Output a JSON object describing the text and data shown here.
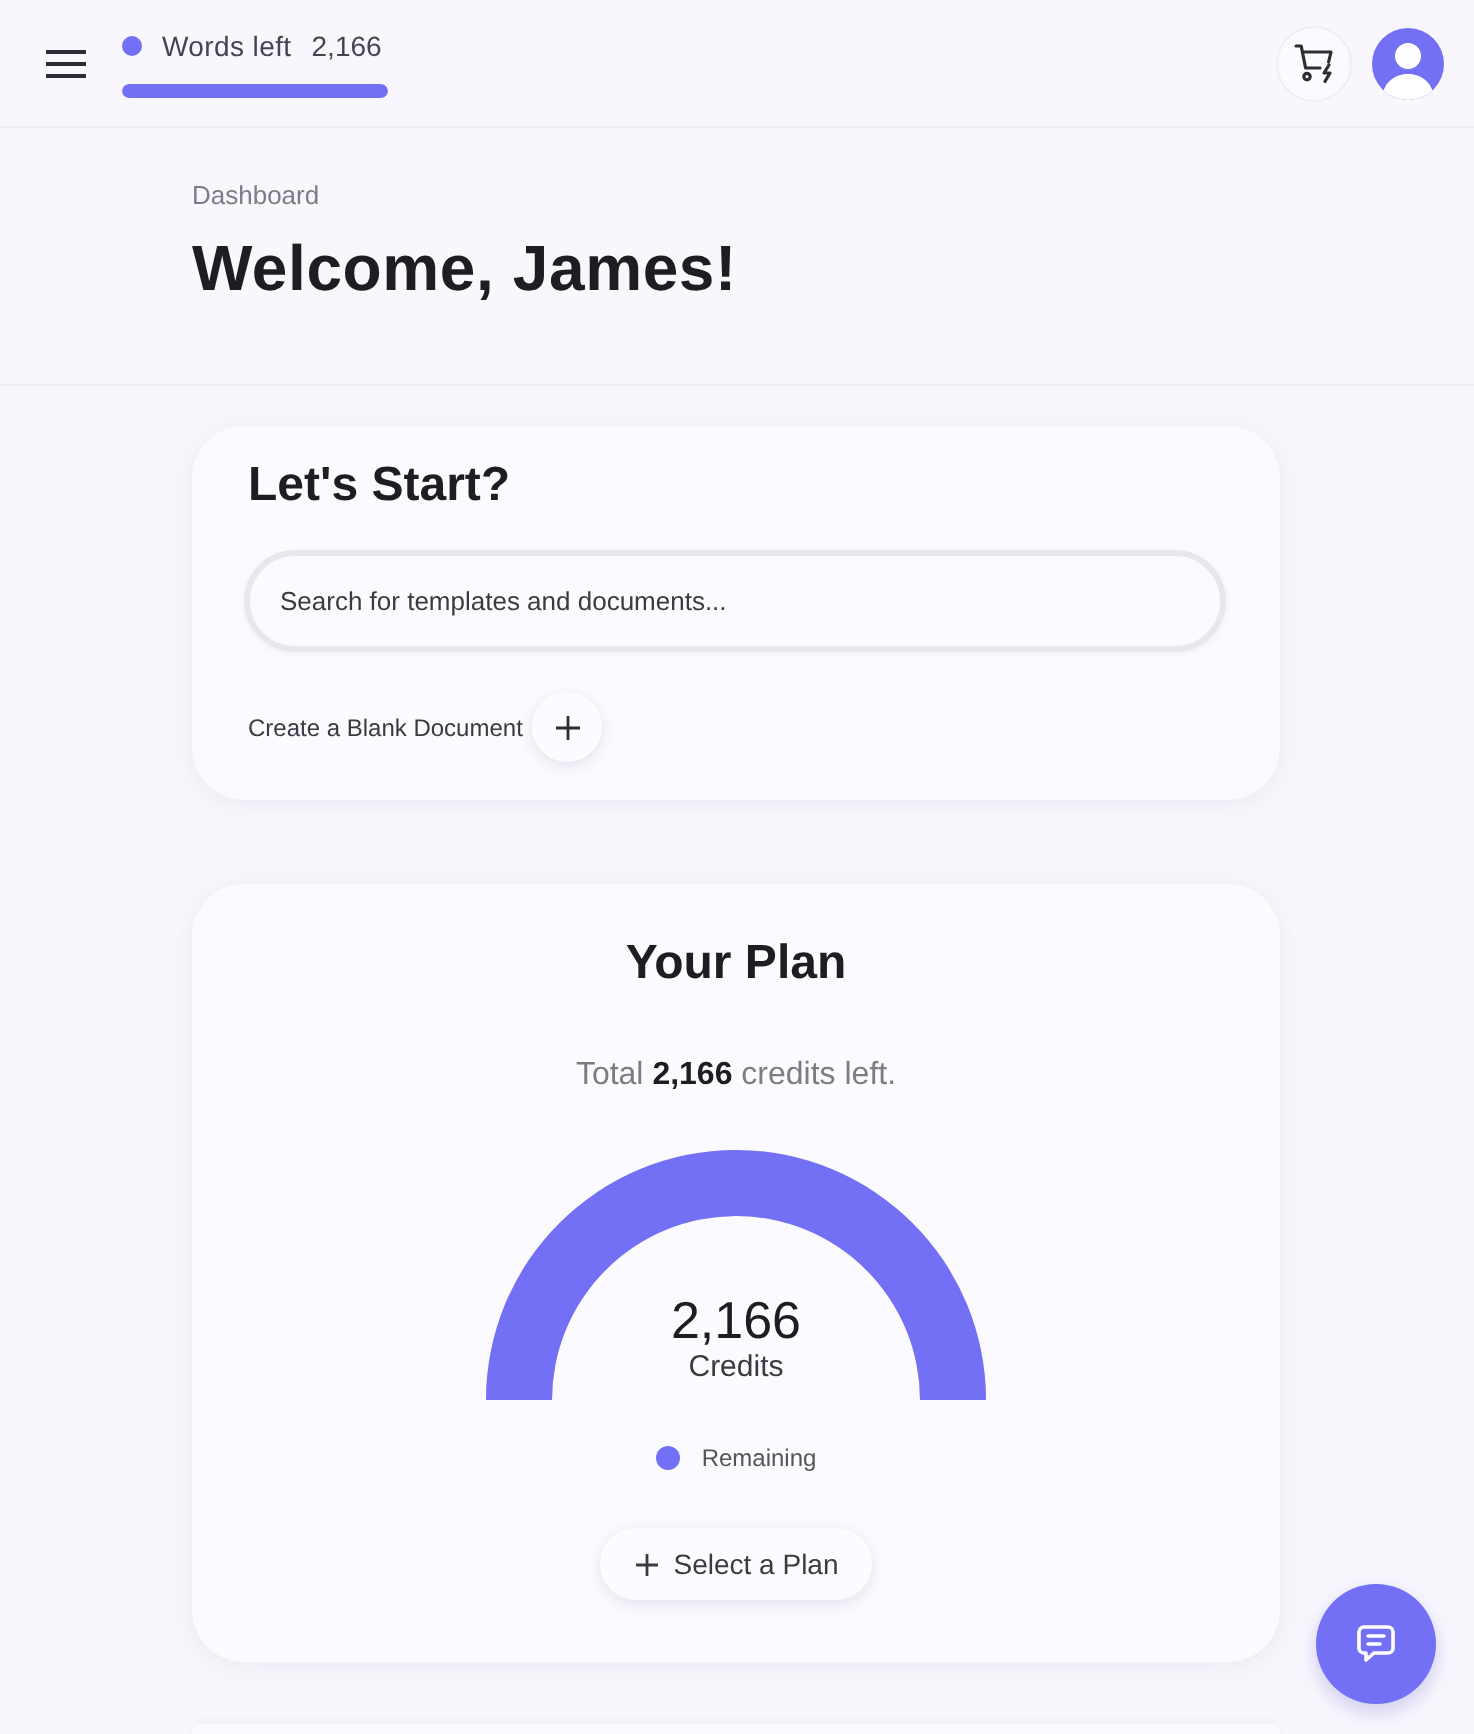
{
  "header": {
    "words_left": {
      "label": "Words left",
      "value": "2,166",
      "level": 1
    }
  },
  "page_header": {
    "breadcrumb": "Dashboard",
    "title": "Welcome, James!"
  },
  "start_card": {
    "title": "Let's Start?",
    "search": {
      "placeholder": "Search for templates and documents..."
    },
    "create_label": "Create a Blank Document"
  },
  "plan_card": {
    "title": "Your Plan",
    "summary": "Total **2,166** credits left.",
    "gauge": {
      "level": 1,
      "value": "2,166",
      "unit": "Credits"
    },
    "legend": [
      {
        "label": "Remaining",
        "color": "#7370f5"
      }
    ],
    "button": "Select a Plan"
  }
}
